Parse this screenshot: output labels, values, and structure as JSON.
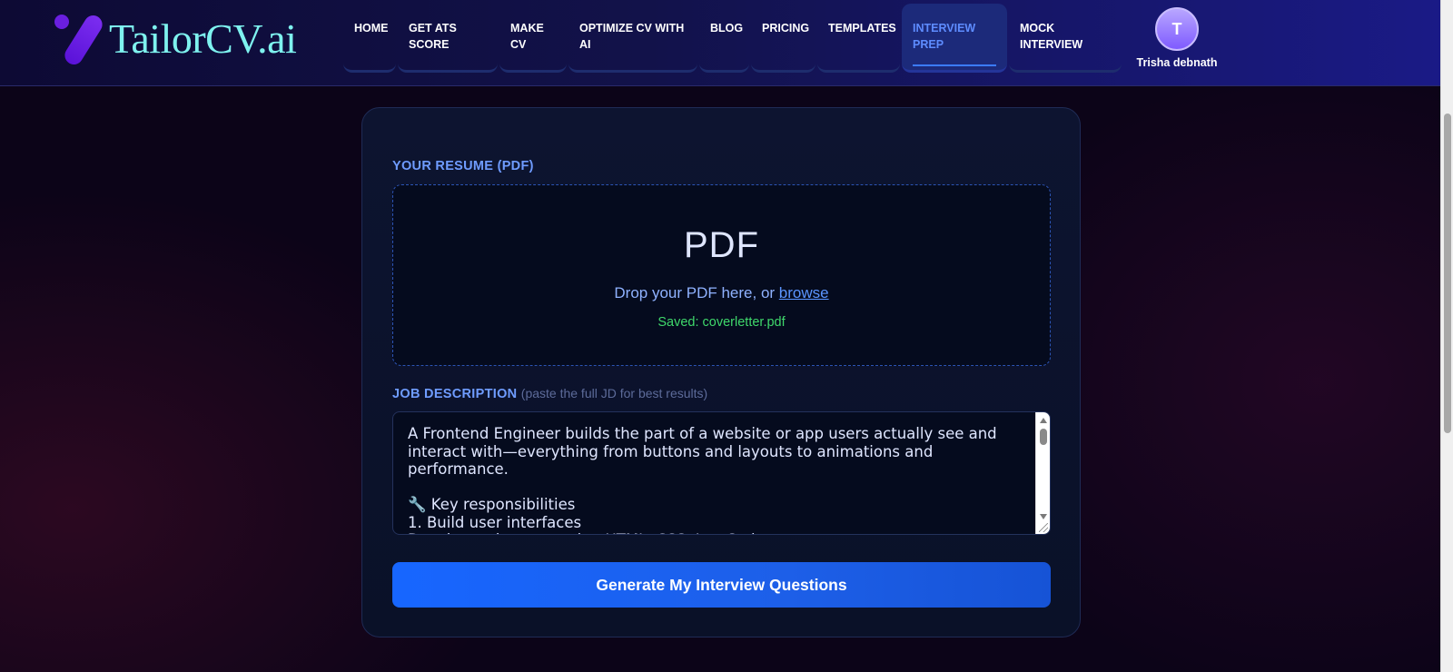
{
  "brand": {
    "name": "TailorCV.ai",
    "icon": "tailorcv-logo-icon"
  },
  "nav": {
    "items": [
      {
        "label": "HOME"
      },
      {
        "label": "GET ATS\nSCORE"
      },
      {
        "label": "MAKE\nCV"
      },
      {
        "label": "OPTIMIZE CV WITH\nAI"
      },
      {
        "label": "BLOG"
      },
      {
        "label": "PRICING"
      },
      {
        "label": "TEMPLATES"
      },
      {
        "label": "INTERVIEW\nPREP",
        "active": true
      },
      {
        "label": "MOCK\nINTERVIEW"
      }
    ]
  },
  "user": {
    "initial": "T",
    "name": "Trisha debnath"
  },
  "form": {
    "resume_label": "YOUR RESUME (PDF)",
    "dropzone": {
      "title": "PDF",
      "prompt": "Drop your PDF here, or ",
      "browse_label": "browse",
      "saved_text": "Saved: coverletter.pdf"
    },
    "jd_label": "JOB DESCRIPTION",
    "jd_hint": "(paste the full JD for best results)",
    "jd_value": "A Frontend Engineer builds the part of a website or app users actually see and interact with—everything from buttons and layouts to animations and performance.\n\n🔧 Key responsibilities\n1. Build user interfaces\nDevelop web pages using HTML, CSS, JavaScript",
    "generate_label": "Generate My Interview Questions"
  },
  "colors": {
    "accent": "#1766ff",
    "brand_text": "#7ef2ef",
    "label": "#6f9cff",
    "success": "#3fd86b",
    "active_nav": "#5e8cff"
  }
}
